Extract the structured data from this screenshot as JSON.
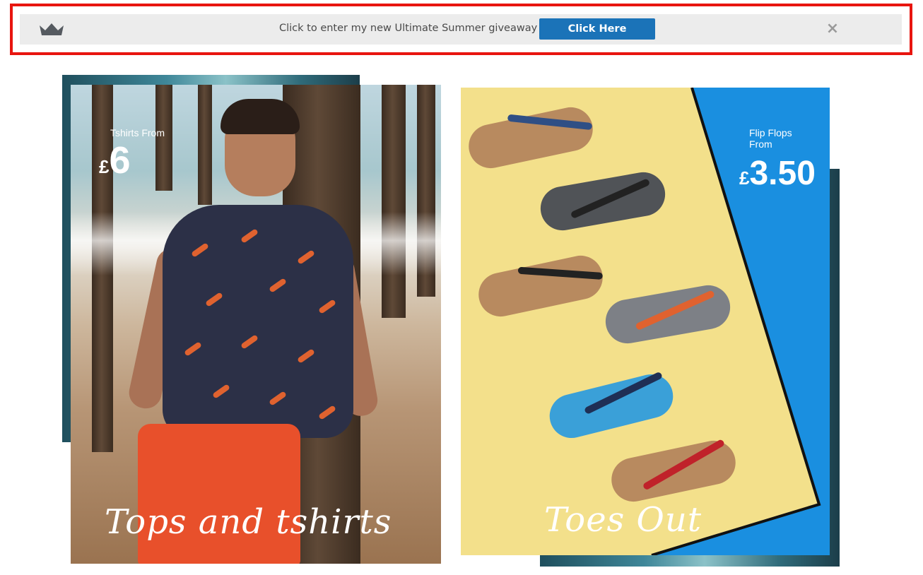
{
  "banner": {
    "icon": "crown-icon",
    "message": "Click to enter my new Ultimate Summer giveaway",
    "button_label": "Click Here",
    "close_label": "×",
    "highlight_color": "#e8150f",
    "button_color": "#1b73b8"
  },
  "tiles": [
    {
      "price_label": "Tshirts From",
      "currency": "£",
      "price": "6",
      "title": "Tops and tshirts"
    },
    {
      "price_label_line1": "Flip Flops",
      "price_label_line2": "From",
      "currency": "£",
      "price": "3.50",
      "title": "Toes Out",
      "accent_color": "#1a8fe0"
    }
  ]
}
